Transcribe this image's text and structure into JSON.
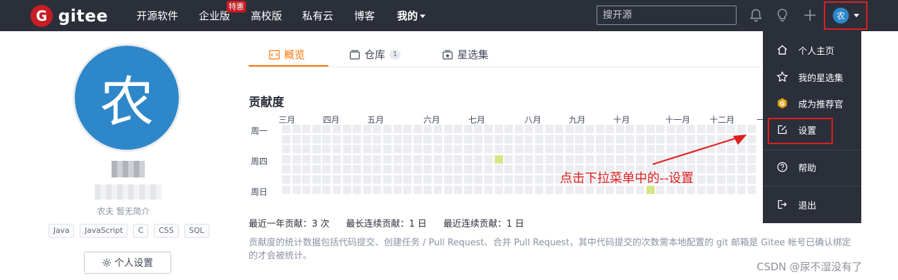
{
  "nav": {
    "logo_mark": "G",
    "logo_text": "gitee",
    "items": [
      {
        "label": "开源软件"
      },
      {
        "label": "企业版"
      },
      {
        "label": "高校版"
      },
      {
        "label": "私有云"
      },
      {
        "label": "博客"
      },
      {
        "label": "我的"
      }
    ],
    "enterprise_badge": "特惠",
    "search_placeholder": "搜开源",
    "avatar_initial": "农"
  },
  "profile": {
    "avatar_initial": "农",
    "bio": "农夫 暂无简介",
    "skills": [
      "Java",
      "JavaScript",
      "C",
      "CSS",
      "SQL"
    ],
    "settings_button": "个人设置"
  },
  "tabs": [
    {
      "label": "概览",
      "active": true
    },
    {
      "label": "仓库",
      "count": "1"
    },
    {
      "label": "星选集"
    }
  ],
  "contribution": {
    "title": "贡献度",
    "months": [
      "三月",
      "四月",
      "五月",
      "六月",
      "七月",
      "八月",
      "九月",
      "十月",
      "十一月",
      "十二月",
      "一"
    ],
    "weekdays": [
      "周一",
      "周四",
      "周日"
    ],
    "active_cells": [
      {
        "week": 21,
        "day": 3,
        "color": "#d6e685"
      },
      {
        "week": 36,
        "day": 6,
        "color": "#d6e685"
      }
    ],
    "stats": {
      "year_total": "最近一年贡献：3 次",
      "longest_streak": "最长连续贡献：1 日",
      "current_streak": "最近连续贡献：1 日"
    },
    "note": "贡献度的统计数据包括代码提交、创建任务 / Pull Request、合并 Pull Request，其中代码提交的次数需本地配置的 git 邮箱是 Gitee 帐号已确认绑定的才会被统计。"
  },
  "dropdown": {
    "items": [
      {
        "label": "个人主页",
        "icon": "home-icon"
      },
      {
        "label": "我的星选集",
        "icon": "star-icon"
      },
      {
        "label": "成为推荐官",
        "icon": "badge-icon"
      },
      {
        "label": "设置",
        "icon": "edit-icon"
      },
      {
        "label": "帮助",
        "icon": "help-icon"
      },
      {
        "label": "退出",
        "icon": "logout-icon"
      }
    ]
  },
  "annotation": {
    "text": "点击下拉菜单中的--设置"
  },
  "watermark": "CSDN @尿不湿没有了",
  "colors": {
    "nav_bg": "#2b2f3a",
    "accent": "#fe7300",
    "brand": "#c71d23",
    "avatar": "#2e87c8",
    "annotation": "#e02020"
  }
}
